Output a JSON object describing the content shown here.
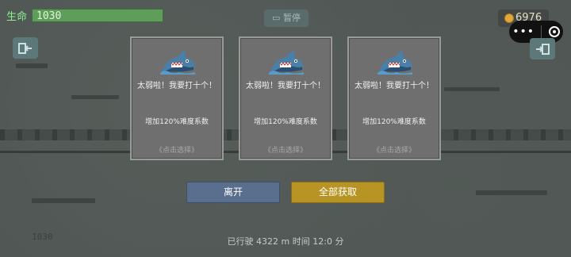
{
  "hud": {
    "life_label": "生命",
    "life_value": "1030",
    "pause_label": "暂停",
    "coin_icon": "coin-icon",
    "coins": "6976"
  },
  "mini_program": {
    "more_label": "•••",
    "close_icon": "target-circle-icon"
  },
  "side_buttons": {
    "left_icon": "exit-left-icon",
    "right_icon": "exit-right-icon"
  },
  "cards": [
    {
      "icon": "shark-icon",
      "title": "太弱啦！我要打十个！",
      "desc": "增加120%难度系数",
      "hint": "《点击选择》"
    },
    {
      "icon": "shark-icon",
      "title": "太弱啦！我要打十个！",
      "desc": "增加120%难度系数",
      "hint": "《点击选择》"
    },
    {
      "icon": "shark-icon",
      "title": "太弱啦！我要打十个！",
      "desc": "增加120%难度系数",
      "hint": "《点击选择》"
    }
  ],
  "buttons": {
    "leave": "离开",
    "take_all": "全部获取"
  },
  "status": {
    "traveled": "已行驶 4322 m  时间 12:0 分",
    "bottom_left": "1030"
  },
  "colors": {
    "life_bar": "#5f9e5a",
    "leave_button": "#5a6e8e",
    "take_all_button": "#b89424"
  }
}
